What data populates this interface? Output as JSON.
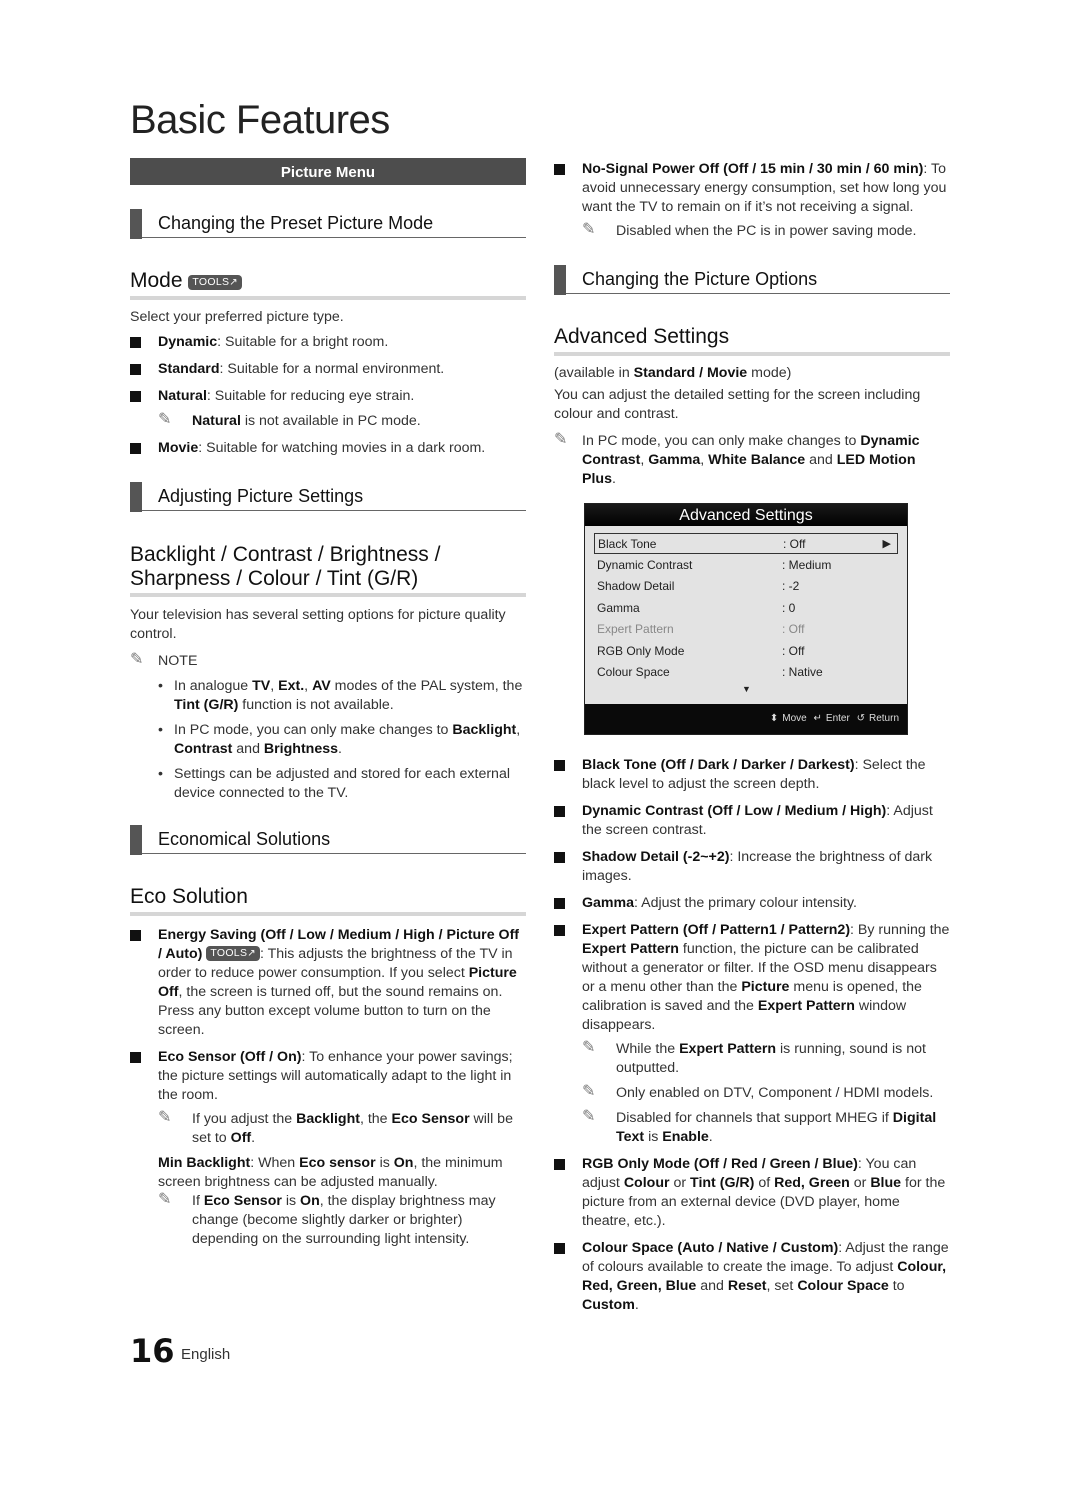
{
  "page_title": "Basic Features",
  "left": {
    "menu_bar": "Picture Menu",
    "sub1": "Changing the Preset Picture Mode",
    "mode_heading": "Mode",
    "tools_badge": "TOOLS",
    "mode_intro": "Select your preferred picture type.",
    "modes": [
      {
        "name": "Dynamic",
        "desc": ": Suitable for a bright room."
      },
      {
        "name": "Standard",
        "desc": ": Suitable for a normal environment."
      },
      {
        "name": "Natural",
        "desc": ": Suitable for reducing eye strain."
      },
      {
        "name": "Movie",
        "desc": ": Suitable for watching movies in a dark room."
      }
    ],
    "natural_note_bold": "Natural",
    "natural_note_text": " is not available in PC mode.",
    "sub2": "Adjusting Picture Settings",
    "h_backlight": "Backlight / Contrast / Brightness / Sharpness / Colour / Tint (G/R)",
    "backlight_intro": "Your television has several setting options for picture quality control.",
    "note_label": "NOTE",
    "notes": {
      "n1_a": "In analogue ",
      "n1_b1": "TV",
      "n1_c": ", ",
      "n1_b2": "Ext.",
      "n1_d": ", ",
      "n1_b3": "AV",
      "n1_e": " modes of the PAL system, the ",
      "n1_b4": "Tint (G/R)",
      "n1_f": " function is not available.",
      "n2_a": "In PC mode, you can only make changes to ",
      "n2_b1": "Backlight",
      "n2_c": ", ",
      "n2_b2": "Contrast",
      "n2_d": " and ",
      "n2_b3": "Brightness",
      "n2_e": ".",
      "n3": "Settings can be adjusted and stored for each external device connected to the TV."
    },
    "sub3": "Economical Solutions",
    "h_eco": "Eco Solution",
    "energy": {
      "bold": "Energy Saving (Off / Low / Medium / High / Picture Off / Auto)",
      "text1": ": This adjusts the brightness of the TV in order to reduce power consumption. If you select ",
      "bold2": "Picture Off",
      "text2": ", the screen is turned off, but the sound remains on. Press any button except volume button to turn on the screen."
    },
    "eco_sensor": {
      "bold": "Eco Sensor (Off / On)",
      "text": ": To enhance your power savings; the picture settings will automatically adapt to the light in the room.",
      "note_a": "If you adjust the ",
      "note_b1": "Backlight",
      "note_c": ", the ",
      "note_b2": "Eco Sensor",
      "note_d": " will be set to ",
      "note_b3": "Off",
      "note_e": ".",
      "min_b1": "Min Backlight",
      "min_a": ": When ",
      "min_b2": "Eco sensor",
      "min_c": " is ",
      "min_b3": "On",
      "min_d": ", the minimum screen brightness can be adjusted manually.",
      "note2_a": "If ",
      "note2_b1": "Eco Sensor",
      "note2_c": " is ",
      "note2_b2": "On",
      "note2_d": ", the display brightness may change (become slightly darker or brighter) depending on the surrounding light intensity."
    }
  },
  "right": {
    "nosignal_bold": "No-Signal Power Off (Off / 15 min / 30 min / 60 min)",
    "nosignal_text": ": To avoid unnecessary energy consumption, set how long you want the TV to remain on if it’s not receiving a signal.",
    "nosignal_note": "Disabled when the PC is in power saving mode.",
    "sub4": "Changing the Picture Options",
    "h_adv": "Advanced Settings",
    "avail_a": "(available in ",
    "avail_b": "Standard / Movie",
    "avail_c": " mode)",
    "adv_intro": "You can adjust the detailed setting for the screen including colour and contrast.",
    "pc_note_a": "In PC mode, you can only make changes to ",
    "pc_note_b1": "Dynamic Contrast",
    "pc_note_c": ", ",
    "pc_note_b2": "Gamma",
    "pc_note_d": ", ",
    "pc_note_b3": "White Balance",
    "pc_note_e": " and ",
    "pc_note_b4": "LED Motion Plus",
    "pc_note_f": ".",
    "osd": {
      "title": "Advanced Settings",
      "rows": [
        {
          "label": "Black Tone",
          "value": ": Off"
        },
        {
          "label": "Dynamic Contrast",
          "value": ": Medium"
        },
        {
          "label": "Shadow Detail",
          "value": ": -2"
        },
        {
          "label": "Gamma",
          "value": ": 0"
        },
        {
          "label": "Expert Pattern",
          "value": ": Off"
        },
        {
          "label": "RGB Only Mode",
          "value": ": Off"
        },
        {
          "label": "Colour Space",
          "value": ": Native"
        }
      ],
      "foot_move": "Move",
      "foot_enter": "Enter",
      "foot_return": "Return"
    },
    "items": {
      "black_tone_b": "Black Tone (Off / Dark / Darker / Darkest)",
      "black_tone_t": ": Select the black level to adjust the screen depth.",
      "dyn_b": "Dynamic Contrast (Off / Low / Medium / High)",
      "dyn_t": ": Adjust the screen contrast.",
      "shadow_b": "Shadow Detail (-2~+2)",
      "shadow_t": ": Increase the brightness of dark images.",
      "gamma_b": "Gamma",
      "gamma_t": ": Adjust the primary colour intensity.",
      "expert_b": "Expert Pattern (Off / Pattern1 / Pattern2)",
      "expert_t1": ": By running the ",
      "expert_b2": "Expert Pattern",
      "expert_t2": " function, the picture can be calibrated without a generator or filter. If the OSD menu disappears or a menu other than the ",
      "expert_b3": "Picture",
      "expert_t3": " menu is opened, the calibration is saved and the ",
      "expert_b4": "Expert Pattern",
      "expert_t4": " window disappears.",
      "expert_n1_a": "While the ",
      "expert_n1_b": "Expert Pattern",
      "expert_n1_c": " is running, sound is not outputted.",
      "expert_n2": "Only enabled on DTV, Component / HDMI models.",
      "expert_n3_a": "Disabled for channels that support MHEG if ",
      "expert_n3_b1": "Digital Text",
      "expert_n3_c": " is ",
      "expert_n3_b2": "Enable",
      "expert_n3_d": ".",
      "rgb_b": "RGB Only Mode (Off / Red / Green / Blue)",
      "rgb_t1": ": You can adjust ",
      "rgb_b2": "Colour",
      "rgb_t2": " or ",
      "rgb_b3": "Tint (G/R)",
      "rgb_t3": " of ",
      "rgb_b4": "Red, Green",
      "rgb_t4": " or ",
      "rgb_b5": "Blue",
      "rgb_t5": " for the picture from an external device (DVD player, home theatre, etc.).",
      "cs_b": "Colour Space (Auto / Native / Custom)",
      "cs_t1": ": Adjust the range of colours available to create the image. To adjust ",
      "cs_b2": "Colour, Red, Green, Blue",
      "cs_t2": " and ",
      "cs_b3": "Reset",
      "cs_t3": ", set ",
      "cs_b4": "Colour Space",
      "cs_t4": " to ",
      "cs_b5": "Custom",
      "cs_t5": "."
    }
  },
  "footer": {
    "page_number": "16",
    "language": "English"
  }
}
